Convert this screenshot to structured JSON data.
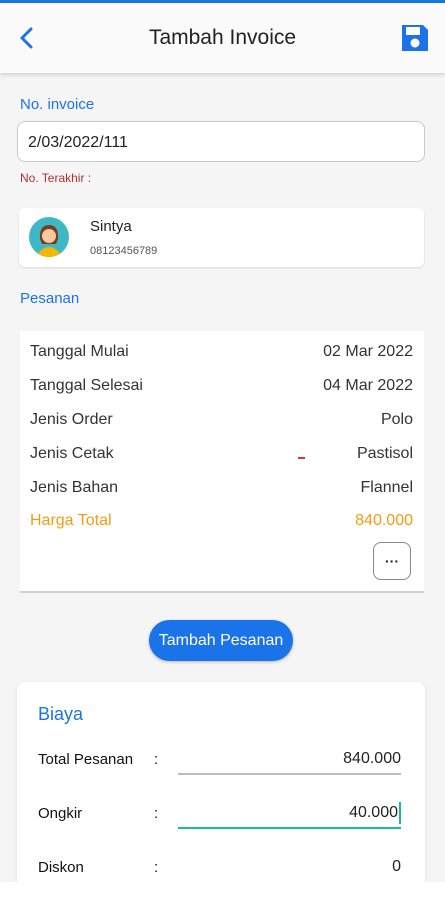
{
  "header": {
    "title": "Tambah Invoice",
    "back_icon": "chevron-left-icon",
    "save_icon": "floppy-disk-icon",
    "accent_color": "#1a73e8"
  },
  "invoice": {
    "label": "No. invoice",
    "value": "2/03/2022/111",
    "last_number_label": "No. Terakhir :"
  },
  "customer": {
    "name": "Sintya",
    "phone": "08123456789",
    "avatar_icon": "female-avatar-icon"
  },
  "orders": {
    "section_label": "Pesanan",
    "rows": [
      {
        "label": "Tanggal Mulai",
        "value": "02 Mar 2022"
      },
      {
        "label": "Tanggal Selesai",
        "value": "04 Mar 2022"
      },
      {
        "label": "Jenis Order",
        "value": "Polo"
      },
      {
        "label": "Jenis Cetak",
        "value": "Pastisol"
      },
      {
        "label": "Jenis Bahan",
        "value": "Flannel"
      },
      {
        "label": "Harga Total",
        "value": "840.000"
      }
    ],
    "more_label": "···",
    "total_color": "#f39c12"
  },
  "add_order_button": "Tambah Pesanan",
  "costs": {
    "title": "Biaya",
    "colon": ":",
    "rows": [
      {
        "label": "Total Pesanan",
        "value": "840.000"
      },
      {
        "label": "Ongkir",
        "value": "40.000"
      },
      {
        "label": "Diskon",
        "value": "0"
      }
    ],
    "active_color": "#1abc9c"
  }
}
